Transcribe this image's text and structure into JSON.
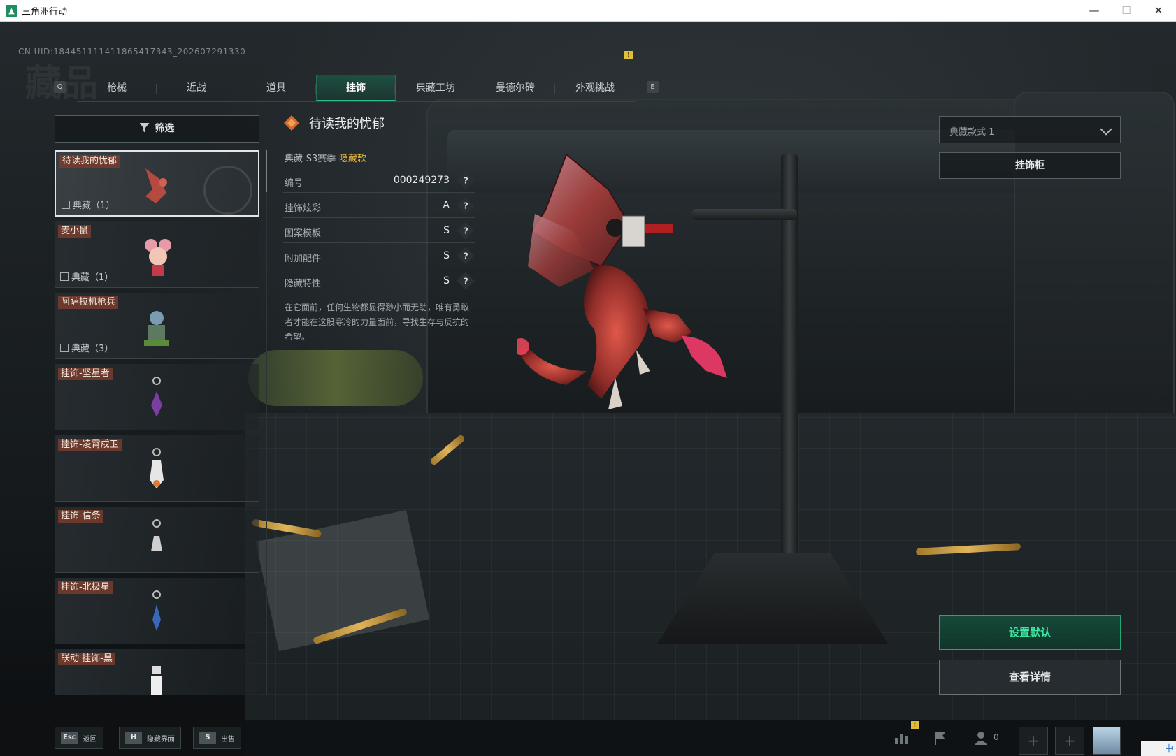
{
  "window": {
    "title": "三角洲行动",
    "minimize": "—",
    "maximize": "☐",
    "close": "✕"
  },
  "uid": "CN UID:18445111141186541734​3_202607291330",
  "watermark": "藏品",
  "tabs": {
    "prev_key": "Q",
    "next_key": "E",
    "items": [
      {
        "label": "枪械",
        "active": false
      },
      {
        "label": "近战",
        "active": false
      },
      {
        "label": "道具",
        "active": false
      },
      {
        "label": "挂饰",
        "active": true
      },
      {
        "label": "典藏工坊",
        "active": false
      },
      {
        "label": "曼德尔砖",
        "active": false
      },
      {
        "label": "外观挑战",
        "active": false
      }
    ],
    "badge": "!"
  },
  "filter": {
    "label": "筛选"
  },
  "list": {
    "items": [
      {
        "name": "待读我的忧郁",
        "count": "典藏（1）",
        "selected": true
      },
      {
        "name": "麦小鼠",
        "count": "典藏（1）",
        "selected": false
      },
      {
        "name": "阿萨拉机枪兵",
        "count": "典藏（3）",
        "selected": false
      },
      {
        "name": "挂饰-坚星者",
        "count": "",
        "selected": false
      },
      {
        "name": "挂饰-凌霄戍卫",
        "count": "",
        "selected": false
      },
      {
        "name": "挂饰-信条",
        "count": "",
        "selected": false
      },
      {
        "name": "挂饰-北极星",
        "count": "",
        "selected": false
      },
      {
        "name": "联动 挂饰-黑",
        "count": "",
        "selected": false
      }
    ]
  },
  "detail": {
    "title": "待读我的忧郁",
    "season_prefix": "典藏-S3赛季-",
    "season_tag": "隐藏款",
    "stats": [
      {
        "label": "编号",
        "value": "000249273"
      },
      {
        "label": "挂饰炫彩",
        "value": "A"
      },
      {
        "label": "图案模板",
        "value": "S"
      },
      {
        "label": "附加配件",
        "value": "S"
      },
      {
        "label": "隐藏特性",
        "value": "S"
      }
    ],
    "help": "?",
    "description": "在它面前，任何生物都显得渺小而无助，唯有勇敢者才能在这股寒冷的力量面前，寻找生存与反抗的希望。"
  },
  "right": {
    "style_select": "典藏款式 1",
    "cabinet": "挂饰柜",
    "set_default": "设置默认",
    "view_details": "查看详情"
  },
  "bottom": {
    "hints": [
      {
        "key": "Esc",
        "label": "返回"
      },
      {
        "key": "H",
        "label": "隐藏界面"
      },
      {
        "key": "S",
        "label": "出售"
      }
    ],
    "friends_count": "0",
    "slot_plus": "+",
    "alert": "!",
    "ime": "中"
  },
  "colors": {
    "accent_green": "#28c08a",
    "hidden_gold": "#e0b640",
    "item_tag": "#7a3c2d"
  }
}
